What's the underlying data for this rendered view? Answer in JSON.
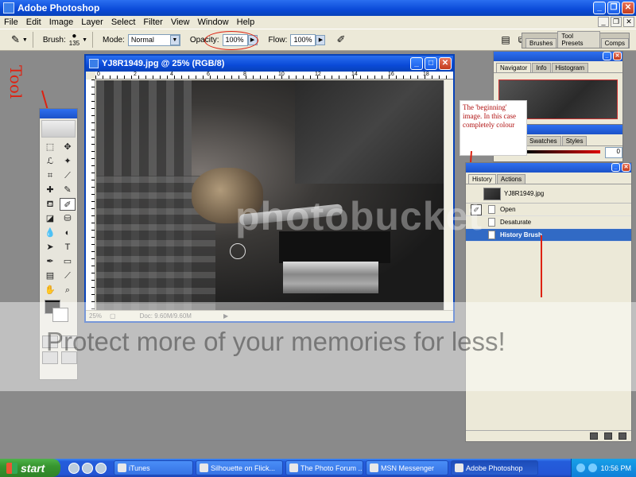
{
  "app": {
    "title": "Adobe Photoshop"
  },
  "menu": [
    "File",
    "Edit",
    "Image",
    "Layer",
    "Select",
    "Filter",
    "View",
    "Window",
    "Help"
  ],
  "options": {
    "brush_label": "Brush:",
    "brush_size": "135",
    "mode_label": "Mode:",
    "mode_value": "Normal",
    "opacity_label": "Opacity:",
    "opacity_value": "100%",
    "flow_label": "Flow:",
    "flow_value": "100%"
  },
  "palette_well": {
    "tabs": [
      "Brushes",
      "Tool Presets",
      "Comps"
    ]
  },
  "annotations": {
    "tool_note": "Tool",
    "history_note": "The 'beginning' image. In this case completely colour",
    "accent": "#dd2211"
  },
  "document": {
    "title": "YJ8R1949.jpg @ 25% (RGB/8)",
    "zoom": "25%",
    "doc_info": "Doc: 9.60M/9.60M",
    "ruler_labels": [
      "0",
      "2",
      "4",
      "6",
      "8",
      "10",
      "12",
      "14",
      "16",
      "18"
    ]
  },
  "navigator": {
    "tabs": [
      "Navigator",
      "Info",
      "Histogram"
    ]
  },
  "color_palette": {
    "tabs": [
      "Swatches",
      "Styles"
    ],
    "value": "0"
  },
  "history": {
    "tabs": [
      "History",
      "Actions"
    ],
    "snapshot": "YJ8R1949.jpg",
    "states": [
      "Open",
      "Desaturate",
      "History Brush"
    ],
    "selected_state": "History Brush",
    "selection_color": "#316ac5"
  },
  "watermark": {
    "text": "Protect more of your memories for less!",
    "logo": "photobucket"
  },
  "taskbar": {
    "start_label": "start",
    "items": [
      "iTunes",
      "Silhouette on Flick...",
      "The Photo Forum ...",
      "MSN Messenger",
      "Adobe Photoshop"
    ],
    "active_item": "Adobe Photoshop",
    "clock": "10:56 PM"
  }
}
